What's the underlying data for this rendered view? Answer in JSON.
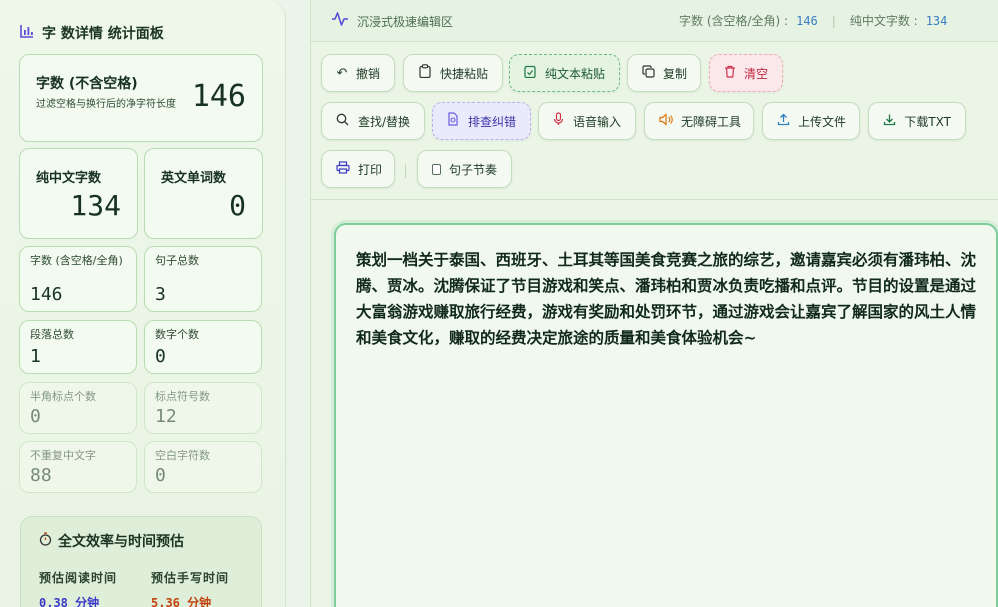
{
  "sidebar": {
    "title": "字  数详情  统计面板",
    "main_card": {
      "label": "字数 (不含空格)",
      "desc": "过滤空格与换行后的净字符长度",
      "value": "146"
    },
    "pure_chinese": {
      "label": "纯中文字数",
      "value": "134"
    },
    "english_words": {
      "label": "英文单词数",
      "value": "0"
    },
    "chars_with_spaces": {
      "label": "字数 (含空格/全角)",
      "value": "146"
    },
    "sentences": {
      "label": "句子总数",
      "value": "3"
    },
    "paragraphs": {
      "label": "段落总数",
      "value": "1"
    },
    "digits": {
      "label": "数字个数",
      "value": "0"
    },
    "half_punct": {
      "label": "半角标点个数",
      "value": "0"
    },
    "punct_total": {
      "label": "标点符号数",
      "value": "12"
    },
    "unique_chinese": {
      "label": "不重复中文字",
      "value": "88"
    },
    "whitespace": {
      "label": "空白字符数",
      "value": "0"
    },
    "efficiency": {
      "title": "全文效率与时间预估",
      "read_label": "预估阅读时间",
      "write_label": "预估手写时间",
      "read_value": "0.38 分钟",
      "write_value": "5.36 分钟",
      "read_color": "#3b38c9",
      "write_color": "#c2410c"
    }
  },
  "topbar": {
    "brand": "沉浸式极速编辑区",
    "chars_label": "字数 (含空格/全角) :",
    "chars_value": "146",
    "separator": "|",
    "chinese_label": "纯中文字数 :",
    "chinese_value": "134"
  },
  "toolbar": {
    "undo": "撤销",
    "quick_paste": "快捷粘贴",
    "plain_paste": "纯文本粘贴",
    "copy": "复制",
    "clear": "清空",
    "find_replace": "查找/替换",
    "check_fix": "排查纠错",
    "voice_input": "语音输入",
    "accessibility": "无障碍工具",
    "upload": "上传文件",
    "download": "下载TXT",
    "print": "打印",
    "sentence_rhythm": "句子节奏"
  },
  "editor": {
    "content": "策划一档关于泰国、西班牙、土耳其等国美食竞赛之旅的综艺，邀请嘉宾必须有潘玮柏、沈腾、贾冰。沈腾保证了节目游戏和笑点、潘玮柏和贾冰负责吃播和点评。节目的设置是通过大富翁游戏赚取旅行经费，游戏有奖励和处罚环节，通过游戏会让嘉宾了解国家的风土人情和美食文化，赚取的经费决定旅途的质量和美食体验机会~"
  },
  "colors": {
    "accent": "#5b4bd8",
    "editor_border": "#7ccf9b",
    "stat_number": "#3a7ec2"
  }
}
